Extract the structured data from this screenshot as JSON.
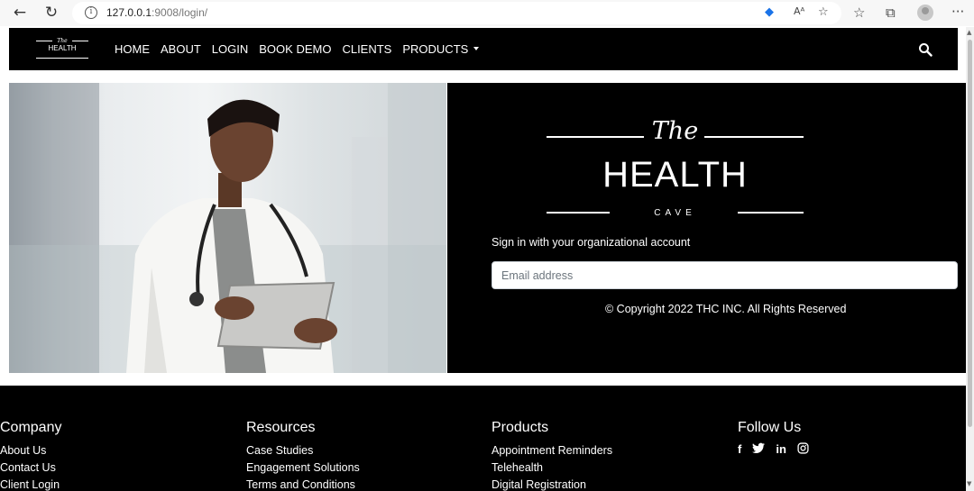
{
  "browser": {
    "url_host": "127.0.0.1",
    "url_path": ":9008/login/"
  },
  "nav": {
    "logo_top": "The",
    "logo_main": "HEALTH",
    "items": [
      "HOME",
      "ABOUT",
      "LOGIN",
      "BOOK DEMO",
      "CLIENTS",
      "PRODUCTS"
    ]
  },
  "logo": {
    "the": "The",
    "health": "HEALTH",
    "cave": "CAVE"
  },
  "login": {
    "signin_text": "Sign in with your organizational account",
    "email_placeholder": "Email address",
    "copyright": "© Copyright 2022 THC INC. All Rights Reserved"
  },
  "footer": {
    "company": {
      "title": "Company",
      "links": [
        "About Us",
        "Contact Us",
        "Client Login"
      ]
    },
    "resources": {
      "title": "Resources",
      "links": [
        "Case Studies",
        "Engagement Solutions",
        "Terms and Conditions"
      ]
    },
    "products": {
      "title": "Products",
      "links": [
        "Appointment Reminders",
        "Telehealth",
        "Digital Registration"
      ]
    },
    "follow": {
      "title": "Follow Us",
      "icons": [
        "f",
        "twitter",
        "in",
        "instagram"
      ]
    }
  }
}
